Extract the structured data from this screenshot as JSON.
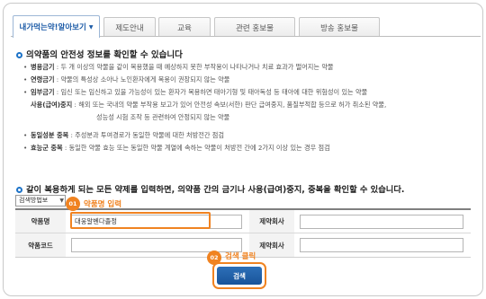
{
  "tabs": [
    {
      "label": "내가먹는약!알아보기",
      "active": true
    },
    {
      "label": "제도안내"
    },
    {
      "label": "교육"
    },
    {
      "label": "관련 홍보물"
    },
    {
      "label": "방송 홍보물"
    }
  ],
  "section1": {
    "title": "의약품의 안전성 정보를 확인할 수 있습니다",
    "items": [
      {
        "term": "병용금기",
        "text": " : 두 개 이상의 약물을 같이 복용했을 때 예상하지 못한 부작용이 나타나거나 치료 효과가 떨어지는 약물"
      },
      {
        "term": "연령금기",
        "text": " : 약물의 특성상 소아나 노인환자에게 복용이 권장되지 않는 약물"
      },
      {
        "term": "임부금기",
        "text": " : 임신 또는 임신하고 있을 가능성이 있는 환자가 복용하면 태아기형 및 태아독성 등 태아에 대한 위험성이 있는 약물"
      },
      {
        "term": "사용(급여)중지",
        "text": " : 해외 또는 국내의 약물 부작용 보고가 있어 안전성 속보(서한) 판단 급여중지, 품질부적합 등으로 허가 취소된 약물,"
      },
      {
        "term": "",
        "text": "성능성 시험 조작 등 관련하여 안정되지 않는 약물"
      },
      {
        "term": "동일성분 중복",
        "text": " : 주성분과 투여경로가 동일한 약물에 대한 처방전간 점검"
      },
      {
        "term": "효능군 중복",
        "text": " : 동일한 약물 효능 또는 동일한 약물 계열에 속하는 약물이 처방전 간에 2가지 이상 있는 경우 점검"
      }
    ]
  },
  "section2": {
    "title": "같이 복용하게 되는 모든 약제를 입력하면, 의약품 간의 금기나 사용(급여)중지, 중복을 확인할 수 있습니다."
  },
  "search": {
    "method_select": "검색방법보",
    "drug_name_label": "약품명",
    "drug_name_value": "대웅알벤다졸정",
    "company_label_1": "제약회사",
    "drug_code_label": "약품코드",
    "company_label_2": "제약회사",
    "button_label": "검색"
  },
  "annotations": {
    "step1_num": "01",
    "step1_text": "약품명 입력",
    "step2_num": "02",
    "step2_text": "검색 클릭"
  },
  "colors": {
    "accent": "#f08321",
    "primary": "#1b5aa6",
    "bullet": "#1d73c8"
  }
}
